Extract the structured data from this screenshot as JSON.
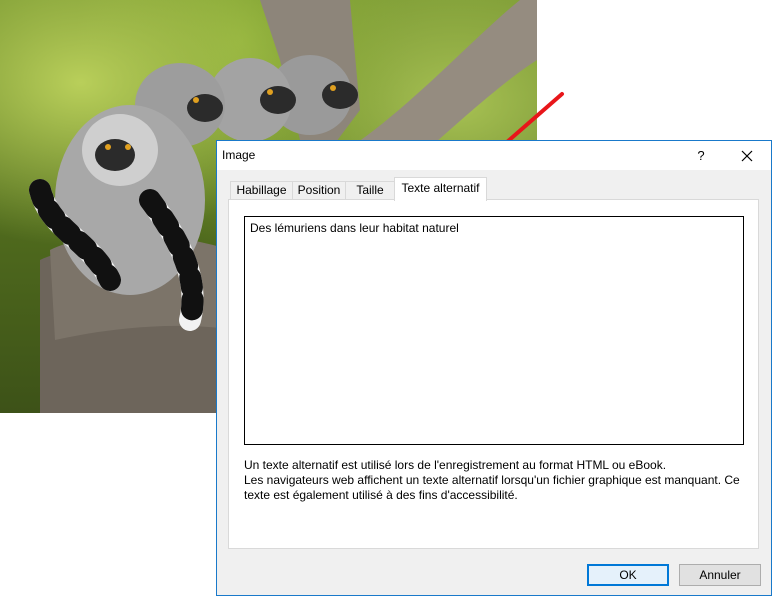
{
  "dialog": {
    "title": "Image",
    "help_glyph": "?",
    "close_glyph": "✕",
    "tabs": [
      {
        "label": "Habillage"
      },
      {
        "label": "Position"
      },
      {
        "label": "Taille"
      },
      {
        "label": "Texte alternatif"
      }
    ],
    "active_tab": "Texte alternatif",
    "alt_text_value": "Des lémuriens dans leur habitat naturel",
    "description_lines": [
      "Un texte alternatif est utilisé lors de l'enregistrement au format HTML ou eBook.",
      "Les navigateurs web affichent un texte alternatif lorsqu'un fichier graphique est manquant. Ce",
      "texte est également utilisé à des fins d'accessibilité."
    ],
    "ok_label": "OK",
    "cancel_label": "Annuler"
  },
  "colors": {
    "accent": "#0078d7",
    "arrow": "#e8161a"
  }
}
